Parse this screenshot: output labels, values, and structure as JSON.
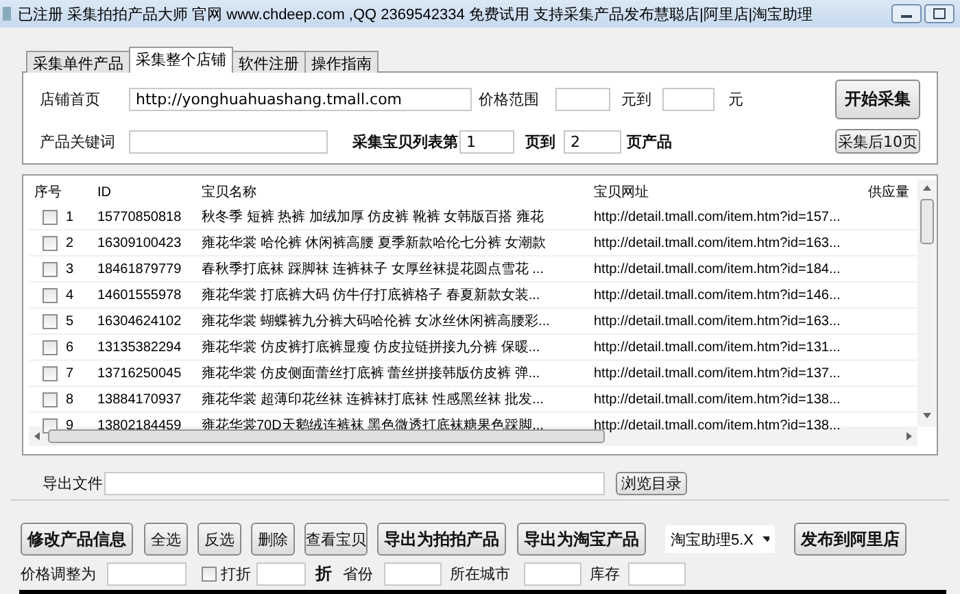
{
  "window": {
    "title": "已注册 采集拍拍产品大师 官网 www.chdeep.com ,QQ 2369542334 免费试用 支持采集产品发布慧聪店|阿里店|淘宝助理"
  },
  "tabs": [
    {
      "label": "采集单件产品",
      "selected": false
    },
    {
      "label": "采集整个店铺",
      "selected": true
    },
    {
      "label": "软件注册",
      "selected": false
    },
    {
      "label": "操作指南",
      "selected": false
    }
  ],
  "store_form": {
    "shop_home_label": "店铺首页",
    "shop_home_value": "http://yonghuahuashang.tmall.com",
    "price_range_label": "价格范围",
    "yuan_to_label": "元到",
    "yuan_label": "元",
    "start_button": "开始采集",
    "keyword_label": "产品关键词",
    "list_page_label": "采集宝贝列表第",
    "page_from_value": "1",
    "page_to_label": "页到",
    "page_to_value": "2",
    "page_products_label": "页产品",
    "next_pages_button": "采集后10页"
  },
  "table": {
    "columns": [
      "序号",
      "ID",
      "宝贝名称",
      "宝贝网址",
      "供应量"
    ],
    "rows": [
      {
        "checked": false,
        "index": "1",
        "id": "15770850818",
        "name": "秋冬季 短裤 热裤 加绒加厚 仿皮裤 靴裤 女韩版百搭 雍花",
        "url": "http://detail.tmall.com/item.htm?id=157..."
      },
      {
        "checked": false,
        "index": "2",
        "id": "16309100423",
        "name": "雍花华裳 哈伦裤 休闲裤高腰 夏季新款哈伦七分裤 女潮款",
        "url": "http://detail.tmall.com/item.htm?id=163..."
      },
      {
        "checked": false,
        "index": "3",
        "id": "18461879779",
        "name": "春秋季打底袜 踩脚袜 连裤袜子 女厚丝袜提花圆点雪花 ...",
        "url": "http://detail.tmall.com/item.htm?id=184..."
      },
      {
        "checked": false,
        "index": "4",
        "id": "14601555978",
        "name": "雍花华裳 打底裤大码 仿牛仔打底裤格子 春夏新款女装...",
        "url": "http://detail.tmall.com/item.htm?id=146..."
      },
      {
        "checked": false,
        "index": "5",
        "id": "16304624102",
        "name": "雍花华裳 蝴蝶裤九分裤大码哈伦裤 女冰丝休闲裤高腰彩...",
        "url": "http://detail.tmall.com/item.htm?id=163..."
      },
      {
        "checked": false,
        "index": "6",
        "id": "13135382294",
        "name": "雍花华裳 仿皮裤打底裤显瘦 仿皮拉链拼接九分裤 保暖...",
        "url": "http://detail.tmall.com/item.htm?id=131..."
      },
      {
        "checked": false,
        "index": "7",
        "id": "13716250045",
        "name": "雍花华裳 仿皮侧面蕾丝打底裤 蕾丝拼接韩版仿皮裤 弹...",
        "url": "http://detail.tmall.com/item.htm?id=137..."
      },
      {
        "checked": false,
        "index": "8",
        "id": "13884170937",
        "name": "雍花华裳 超薄印花丝袜 连裤袜打底袜 性感黑丝袜 批发...",
        "url": "http://detail.tmall.com/item.htm?id=138..."
      },
      {
        "checked": false,
        "index": "9",
        "id": "13802184459",
        "name": "雍花华裳70D天鹅绒连裤袜 黑色微透打底袜糖果色踩脚...",
        "url": "http://detail.tmall.com/item.htm?id=138..."
      }
    ]
  },
  "export": {
    "label": "导出文件",
    "browse_button": "浏览目录"
  },
  "actions": [
    {
      "kind": "primary",
      "label": "修改产品信息"
    },
    {
      "kind": "normal",
      "label": "全选"
    },
    {
      "kind": "normal",
      "label": "反选"
    },
    {
      "kind": "normal",
      "label": "删除"
    },
    {
      "kind": "normal",
      "label": "查看宝贝"
    },
    {
      "kind": "primary",
      "label": "导出为拍拍产品"
    },
    {
      "kind": "primary",
      "label": "导出为淘宝产品"
    },
    {
      "kind": "dropdown",
      "label": "淘宝助理5.X"
    },
    {
      "kind": "primary",
      "label": "发布到阿里店"
    }
  ],
  "adjust": {
    "price_adjust_label": "价格调整为",
    "discount": {
      "label": "打折",
      "checked": false
    },
    "discount_unit": "折",
    "province_label": "省份",
    "city_label": "所在城市",
    "stock_label": "库存"
  }
}
